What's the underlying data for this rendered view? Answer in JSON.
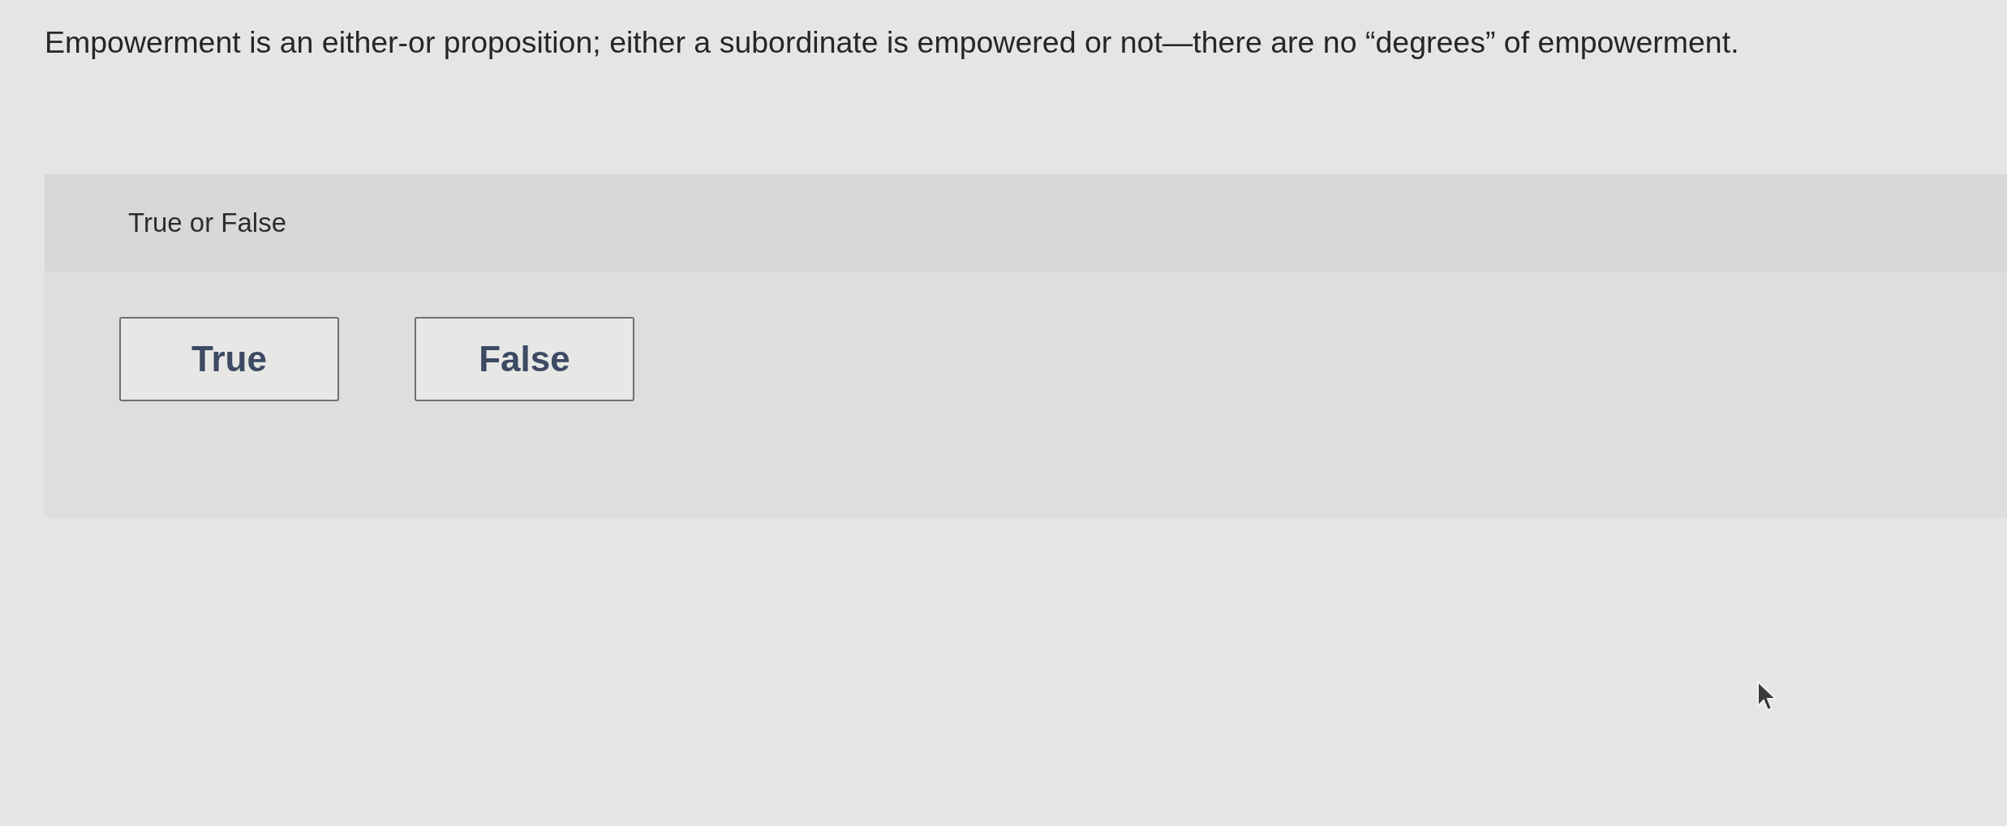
{
  "question": {
    "text": "Empowerment is an either-or proposition; either a subordinate is empowered or not—there are no “degrees” of empowerment."
  },
  "panel": {
    "prompt": "True or False",
    "options": [
      {
        "label": "True",
        "selected": false
      },
      {
        "label": "False",
        "selected": false
      }
    ]
  }
}
